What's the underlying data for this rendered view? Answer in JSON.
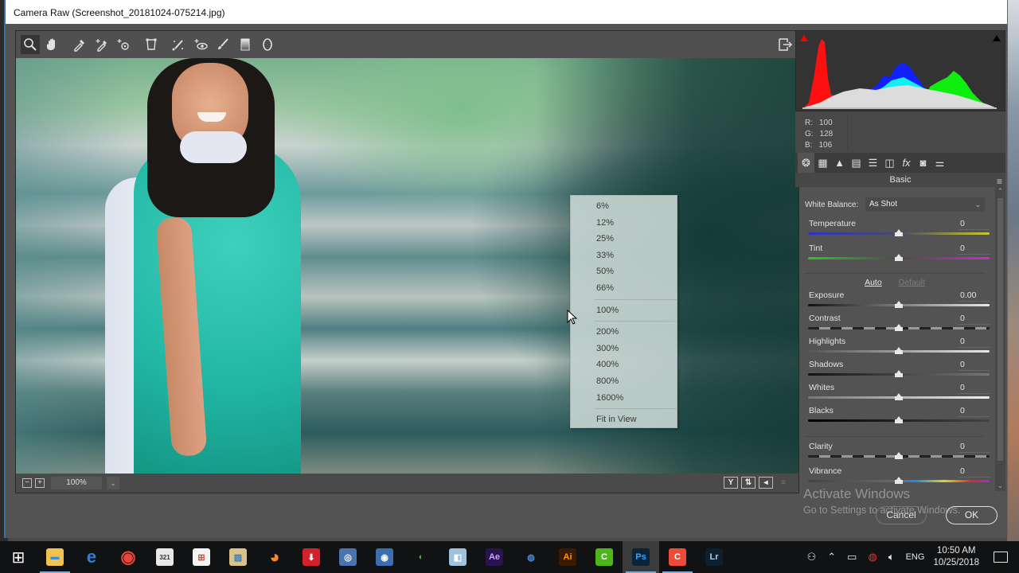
{
  "window": {
    "title": "Camera Raw (Screenshot_20181024-075214.jpg)"
  },
  "toolbar": {
    "tools": [
      {
        "name": "zoom-tool",
        "icon": "magnifier-icon",
        "active": true
      },
      {
        "name": "hand-tool",
        "icon": "hand-icon"
      },
      {
        "name": "white-balance-tool",
        "icon": "eyedropper-icon"
      },
      {
        "name": "color-sampler-tool",
        "icon": "color-sampler-icon"
      },
      {
        "name": "targeted-adjustment-tool",
        "icon": "target-adjust-icon"
      },
      {
        "name": "transform-tool",
        "icon": "transform-icon"
      },
      {
        "name": "spot-removal-tool",
        "icon": "spot-removal-icon"
      },
      {
        "name": "red-eye-tool",
        "icon": "red-eye-icon"
      },
      {
        "name": "adjustment-brush-tool",
        "icon": "brush-icon"
      },
      {
        "name": "graduated-filter-tool",
        "icon": "graduated-filter-icon"
      },
      {
        "name": "radial-filter-tool",
        "icon": "radial-filter-icon"
      }
    ],
    "open_in_photoshop_icon": "open-preferences-icon"
  },
  "zoom_menu": {
    "groups": [
      [
        "6%",
        "12%",
        "25%",
        "33%",
        "50%",
        "66%"
      ],
      [
        "100%"
      ],
      [
        "200%",
        "300%",
        "400%",
        "800%",
        "1600%"
      ],
      [
        "Fit in View"
      ]
    ]
  },
  "preview_bottom": {
    "zoom_out_label": "−",
    "zoom_in_label": "+",
    "zoom_level": "100%",
    "view_buttons": [
      "Y",
      "⇅",
      "◂",
      "≡"
    ]
  },
  "histogram": {
    "readout": {
      "r_label": "R:",
      "r": "100",
      "g_label": "G:",
      "g": "128",
      "b_label": "B:",
      "b": "106"
    },
    "shadow_clip_color": "#ff0000",
    "highlight_clip_color": "#000000"
  },
  "panel_tabs": [
    {
      "name": "basic",
      "icon": "aperture-icon",
      "glyph": "❂",
      "active": true
    },
    {
      "name": "tone-curve",
      "icon": "tone-curve-icon",
      "glyph": "▦"
    },
    {
      "name": "detail",
      "icon": "detail-icon",
      "glyph": "▲"
    },
    {
      "name": "hsl",
      "icon": "hsl-icon",
      "glyph": "▤"
    },
    {
      "name": "split-toning",
      "icon": "split-toning-icon",
      "glyph": "☰"
    },
    {
      "name": "lens-corrections",
      "icon": "lens-icon",
      "glyph": "◫"
    },
    {
      "name": "effects",
      "icon": "fx-icon",
      "glyph": "fx"
    },
    {
      "name": "camera-calibration",
      "icon": "camera-icon",
      "glyph": "◙"
    },
    {
      "name": "presets",
      "icon": "sliders-icon",
      "glyph": "⚌"
    }
  ],
  "basic_panel": {
    "title": "Basic",
    "white_balance": {
      "label": "White Balance:",
      "value": "As Shot"
    },
    "auto_label": "Auto",
    "default_label": "Default",
    "sliders": [
      {
        "label": "Temperature",
        "value": "0",
        "position": 0.5,
        "track": "temperature"
      },
      {
        "label": "Tint",
        "value": "0",
        "position": 0.5,
        "track": "tint"
      },
      {
        "label": "Exposure",
        "value": "0.00",
        "position": 0.5,
        "track": "exposure"
      },
      {
        "label": "Contrast",
        "value": "0",
        "position": 0.5,
        "track": "contrast"
      },
      {
        "label": "Highlights",
        "value": "0",
        "position": 0.5,
        "track": "highlights"
      },
      {
        "label": "Shadows",
        "value": "0",
        "position": 0.5,
        "track": "shadows"
      },
      {
        "label": "Whites",
        "value": "0",
        "position": 0.5,
        "track": "whites"
      },
      {
        "label": "Blacks",
        "value": "0",
        "position": 0.5,
        "track": "blacks"
      },
      {
        "label": "Clarity",
        "value": "0",
        "position": 0.5,
        "track": "clarity"
      },
      {
        "label": "Vibrance",
        "value": "0",
        "position": 0.5,
        "track": "vibrance"
      }
    ]
  },
  "dialog_buttons": {
    "cancel": "Cancel",
    "ok": "OK"
  },
  "activation": {
    "title": "Activate Windows",
    "subtitle": "Go to Settings to activate Windows."
  },
  "taskbar": {
    "apps": [
      {
        "name": "start",
        "label": "⊞",
        "bg": "transparent",
        "fg": "#ffffff"
      },
      {
        "name": "file-explorer",
        "label": "▬",
        "bg": "#f2c14e",
        "fg": "#3b8ed8"
      },
      {
        "name": "edge",
        "label": "e",
        "bg": "transparent",
        "fg": "#2f7fd8"
      },
      {
        "name": "chrome",
        "label": "◉",
        "bg": "transparent",
        "fg": "#e4463b"
      },
      {
        "name": "media-player-classic",
        "label": "321",
        "bg": "#e8e8e8",
        "fg": "#333"
      },
      {
        "name": "microsoft-store",
        "label": "⊞",
        "bg": "#f4f4f4",
        "fg": "#d04a2f"
      },
      {
        "name": "photos",
        "label": "▨",
        "bg": "#d9c38a",
        "fg": "#3c7cb0"
      },
      {
        "name": "firefox",
        "label": "◕",
        "bg": "transparent",
        "fg": "#ff8a1c"
      },
      {
        "name": "downloader",
        "label": "⬇",
        "bg": "#d3212c",
        "fg": "#ffffff"
      },
      {
        "name": "media-app-1",
        "label": "◎",
        "bg": "#4a74b0",
        "fg": "#ffffff"
      },
      {
        "name": "media-app-2",
        "label": "◉",
        "bg": "#3d6fb0",
        "fg": "#ffffff"
      },
      {
        "name": "internet-download-manager",
        "label": "◐",
        "bg": "transparent",
        "fg": "#4ab04a"
      },
      {
        "name": "notepad",
        "label": "◧",
        "bg": "#9fc3dc",
        "fg": "#ffffff"
      },
      {
        "name": "after-effects",
        "label": "Ae",
        "bg": "#2a1450",
        "fg": "#c9a6ff"
      },
      {
        "name": "media-app-3",
        "label": "◍",
        "bg": "transparent",
        "fg": "#4a8ad8"
      },
      {
        "name": "illustrator",
        "label": "Ai",
        "bg": "#3a1a00",
        "fg": "#ff9a00"
      },
      {
        "name": "camtasia",
        "label": "C",
        "bg": "#4bb71b",
        "fg": "#ffffff"
      },
      {
        "name": "photoshop",
        "label": "Ps",
        "bg": "#0a2438",
        "fg": "#31a8ff",
        "active": true
      },
      {
        "name": "camtasia-recorder",
        "label": "C",
        "bg": "#ee4a38",
        "fg": "#ffffff"
      },
      {
        "name": "lightroom",
        "label": "Lr",
        "bg": "#0c2030",
        "fg": "#b4cfe4"
      }
    ],
    "tray": {
      "people_icon": "people-icon",
      "show_hidden_icon": "chevron-up-icon",
      "battery_icon": "battery-icon",
      "network_icon": "wifi-disconnected-icon",
      "volume_icon": "volume-icon",
      "language": "ENG",
      "time": "10:50 AM",
      "date": "10/25/2018",
      "notifications_icon": "action-center-icon"
    }
  }
}
